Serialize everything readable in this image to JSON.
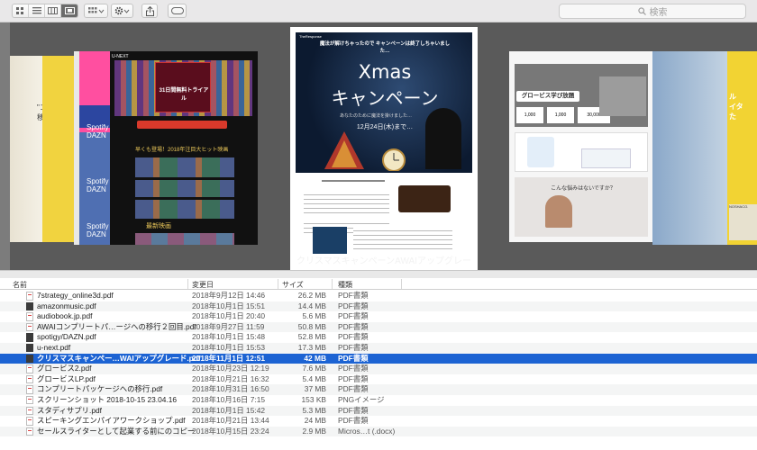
{
  "toolbar": {
    "view_modes": [
      "icon-view",
      "list-view",
      "column-view",
      "coverflow-view"
    ],
    "active_view": "coverflow-view",
    "search_placeholder": "検索"
  },
  "coverflow": {
    "selected_label": "クリスマスキャンペーンAWAIアップグレード.pdf",
    "center_doc": {
      "brand": "TheResponse",
      "header_text": "魔法が解けちゃったので キャンペーンは終了しちゃいました…",
      "title": "Xmas",
      "title_jp": "キャンペーン",
      "subtitle": "あなたのために魔法を掛けました…",
      "date_text": "12月24日(木)まで…"
    },
    "left_doc": {
      "brand": "U-NEXT",
      "headline": "31日間無料トライアル",
      "section1": "早くも登場！2018年注目大ヒット映画",
      "section2": "最新映画"
    },
    "right_doc": {
      "headline": "グロービス学び放題",
      "stat1": "1,000",
      "stat2": "1,000",
      "stat3": "30,000",
      "question": "こんな悩みはないですか？"
    }
  },
  "columns": {
    "name": "名前",
    "date": "変更日",
    "size": "サイズ",
    "kind": "種類"
  },
  "files": [
    {
      "name": "7strategy_online3d.pdf",
      "date": "2018年9月12日 14:46",
      "size": "26.2 MB",
      "kind": "PDF書類",
      "icon": "pdf"
    },
    {
      "name": "amazonmusic.pdf",
      "date": "2018年10月1日 15:51",
      "size": "14.4 MB",
      "kind": "PDF書類",
      "icon": "dark"
    },
    {
      "name": "audiobook.jp.pdf",
      "date": "2018年10月1日 20:40",
      "size": "5.6 MB",
      "kind": "PDF書類",
      "icon": "pdf"
    },
    {
      "name": "AWAIコンプリートパ…ージへの移行２回目.pdf",
      "date": "2018年9月27日 11:59",
      "size": "50.8 MB",
      "kind": "PDF書類",
      "icon": "pdf"
    },
    {
      "name": "spotigy/DAZN.pdf",
      "date": "2018年10月1日 15:48",
      "size": "52.8 MB",
      "kind": "PDF書類",
      "icon": "dark"
    },
    {
      "name": "u-next.pdf",
      "date": "2018年10月1日 15:53",
      "size": "17.3 MB",
      "kind": "PDF書類",
      "icon": "dark"
    },
    {
      "name": "クリスマスキャンペー…WAIアップグレード.pdf",
      "date": "2018年11月1日 12:51",
      "size": "42 MB",
      "kind": "PDF書類",
      "icon": "dark",
      "selected": true
    },
    {
      "name": "グロービス2.pdf",
      "date": "2018年10月23日 12:19",
      "size": "7.6 MB",
      "kind": "PDF書類",
      "icon": "pdf"
    },
    {
      "name": "グロービスLP.pdf",
      "date": "2018年10月21日 16:32",
      "size": "5.4 MB",
      "kind": "PDF書類",
      "icon": "pdf"
    },
    {
      "name": "コンプリートパッケージへの移行.pdf",
      "date": "2018年10月31日 16:50",
      "size": "37 MB",
      "kind": "PDF書類",
      "icon": "pdf"
    },
    {
      "name": "スクリーンショット 2018-10-15 23.04.16",
      "date": "2018年10月16日 7:15",
      "size": "153 KB",
      "kind": "PNGイメージ",
      "icon": "pdf"
    },
    {
      "name": "スタディサプリ.pdf",
      "date": "2018年10月1日 15:42",
      "size": "5.3 MB",
      "kind": "PDF書類",
      "icon": "pdf"
    },
    {
      "name": "スピーキングエンパイアワークショップ.pdf",
      "date": "2018年10月21日 13:44",
      "size": "24 MB",
      "kind": "PDF書類",
      "icon": "pdf"
    },
    {
      "name": "セールスライターとして起業する前にのコピー",
      "date": "2018年10月15日 23:24",
      "size": "2.9 MB",
      "kind": "Micros…t (.docx)",
      "icon": "pdf"
    }
  ]
}
